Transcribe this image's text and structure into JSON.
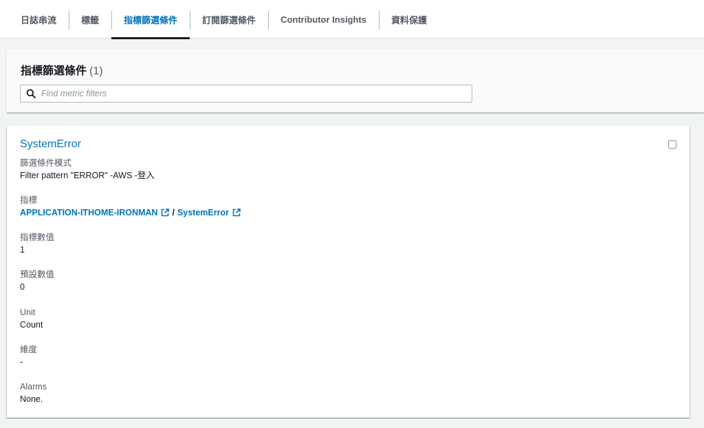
{
  "tabs": [
    {
      "label": "日誌串流"
    },
    {
      "label": "標籤"
    },
    {
      "label": "指標篩選條件"
    },
    {
      "label": "訂閱篩選條件"
    },
    {
      "label": "Contributor Insights"
    },
    {
      "label": "資料保護"
    }
  ],
  "active_tab": "指標篩選條件",
  "header": {
    "title": "指標篩選條件",
    "count": "(1)",
    "search_placeholder": "Find metric filters"
  },
  "filter": {
    "name": "SystemError",
    "pattern_label": "篩選條件模式",
    "pattern_value": "Filter pattern \"ERROR\" -AWS -登入",
    "metric_label": "指標",
    "metric_namespace": "APPLICATION-ITHOME-IRONMAN",
    "metric_separator": "/",
    "metric_name": "SystemError",
    "metric_value_label": "指標數值",
    "metric_value": "1",
    "default_value_label": "預設數值",
    "default_value": "0",
    "unit_label": "Unit",
    "unit_value": "Count",
    "dimensions_label": "維度",
    "dimensions_value": "-",
    "alarms_label": "Alarms",
    "alarms_value": "None."
  },
  "colors": {
    "link": "#0073bb",
    "text": "#16191f",
    "muted": "#545b64",
    "background": "#f2f3f3"
  },
  "icons": {
    "search": "search-icon",
    "external": "external-link-icon"
  }
}
